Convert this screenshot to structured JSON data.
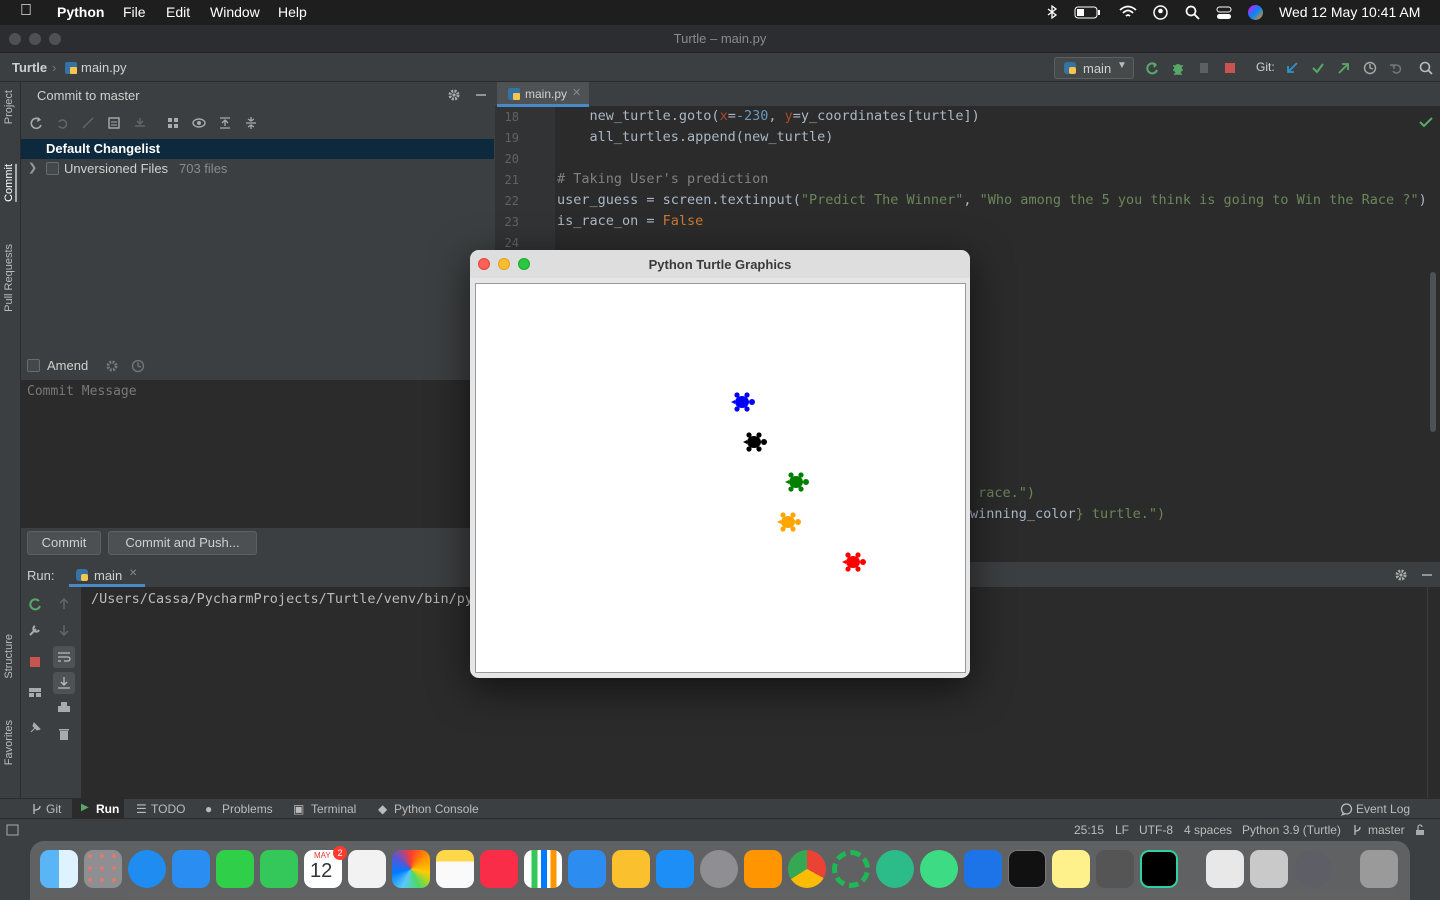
{
  "menubar": {
    "app": "Python",
    "items": [
      "File",
      "Edit",
      "Window",
      "Help"
    ],
    "clock": "Wed 12 May  10:41 AM"
  },
  "window": {
    "title": "Turtle – main.py"
  },
  "navbar": {
    "project": "Turtle",
    "file": "main.py",
    "run_config": "main",
    "git_label": "Git:"
  },
  "left_strip": {
    "tabs": [
      "Project",
      "Commit",
      "Pull Requests",
      "Structure",
      "Favorites"
    ]
  },
  "commit_panel": {
    "title": "Commit to master",
    "changelist": "Default Changelist",
    "unversioned_label": "Unversioned Files",
    "unversioned_count": "703 files",
    "amend_label": "Amend",
    "message_placeholder": "Commit Message",
    "commit_button": "Commit",
    "commit_push_button": "Commit and Push..."
  },
  "editor": {
    "tab": "main.py",
    "lines": [
      {
        "n": "18",
        "html": "    new_turtle.goto(<span class='param'>x</span>=<span class='num'>-230</span>, <span class='param'>y</span>=y_coordinates[turtle])"
      },
      {
        "n": "19",
        "html": "    all_turtles.append(new_turtle)"
      },
      {
        "n": "20",
        "html": ""
      },
      {
        "n": "21",
        "html": "<span class='cmt'># Taking User's prediction</span>"
      },
      {
        "n": "22",
        "html": "user_guess = screen.textinput(<span class='str'>\"Predict The Winner\"</span>, <span class='str'>\"Who among the 5 you think is going to Win the Race ?\"</span>)"
      },
      {
        "n": "23",
        "html": "is_race_on = <span class='kw'>False</span>"
      },
      {
        "n": "24",
        "html": ""
      }
    ],
    "partial_1": " race.\")",
    "partial_2_var": "winning_color",
    "partial_2_rest": "} turtle.\")"
  },
  "run_panel": {
    "label": "Run:",
    "tab": "main",
    "output": "/Users/Cassa/PycharmProjects/Turtle/venv/bin/python"
  },
  "bottom_tabs": [
    "Git",
    "Run",
    "TODO",
    "Problems",
    "Terminal",
    "Python Console"
  ],
  "event_log": "Event Log",
  "status": {
    "position": "25:15",
    "line_sep": "LF",
    "encoding": "UTF-8",
    "indent": "4 spaces",
    "interpreter": "Python 3.9 (Turtle)",
    "branch": "master"
  },
  "turtle_window": {
    "title": "Python Turtle Graphics",
    "turtles": [
      {
        "color": "#0000ff",
        "name": "blue"
      },
      {
        "color": "#000000",
        "name": "black"
      },
      {
        "color": "#008000",
        "name": "green"
      },
      {
        "color": "#ffa500",
        "name": "orange"
      },
      {
        "color": "#ff0000",
        "name": "red"
      }
    ]
  },
  "dock": {
    "calendar_month": "MAY",
    "calendar_day": "12",
    "calendar_badge": "2"
  }
}
